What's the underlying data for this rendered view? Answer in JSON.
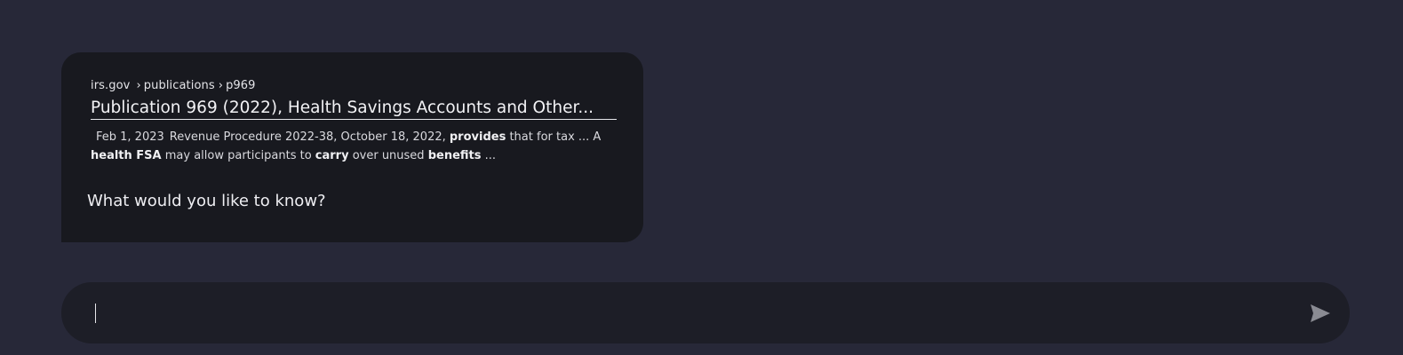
{
  "search_result": {
    "breadcrumb": {
      "domain": "irs.gov",
      "path1": "publications",
      "path2": "p969",
      "separator": "›"
    },
    "title": "Publication 969 (2022), Health Savings Accounts and Other...",
    "snippet": {
      "date": "Feb 1, 2023",
      "text_1": "Revenue Procedure 2022-38, October 18, 2022, ",
      "bold_1": "provides",
      "text_2": " that for tax ... A ",
      "bold_2": "health FSA",
      "text_3": " may allow participants to ",
      "bold_3": "carry",
      "text_4": " over unused ",
      "bold_4": "benefits",
      "text_5": " ..."
    },
    "prompt": "What would you like to know?"
  },
  "chat_input": {
    "value": "",
    "placeholder": "",
    "send_icon": "send-arrow-icon"
  },
  "colors": {
    "background": "#272838",
    "card": "#18191f",
    "input_bar": "#1d1e27",
    "send_icon": "#8a8b93"
  }
}
